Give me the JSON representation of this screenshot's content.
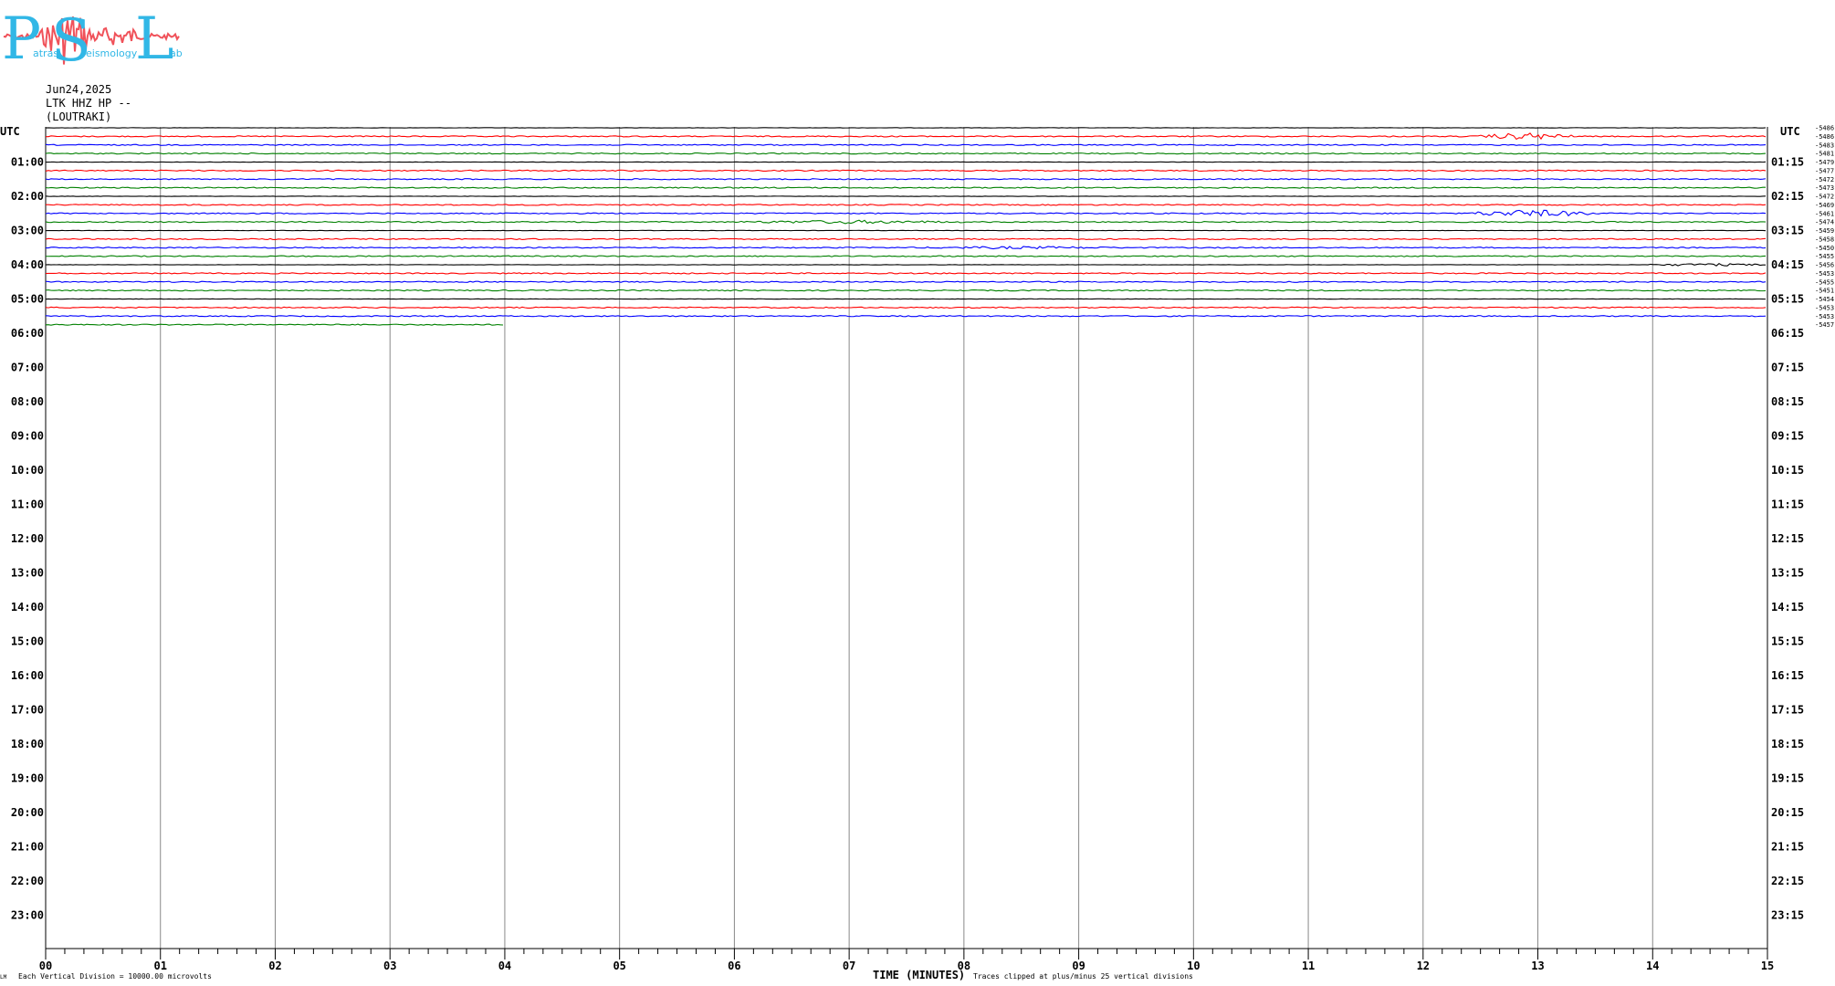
{
  "logo": {
    "letters": [
      "P",
      "S",
      "L"
    ],
    "fragments": [
      "atras",
      "eismology",
      "ab"
    ],
    "colors": {
      "letters": "#31b7e6",
      "trace": "#f0525a"
    }
  },
  "header": {
    "date": "Jun24,2025",
    "channel": "LTK HHZ HP --",
    "station": "(LOUTRAKI)"
  },
  "chart_data": {
    "type": "line",
    "x_axis_label": "TIME (MINUTES)",
    "x_range": [
      0,
      15
    ],
    "x_ticks": [
      "00",
      "01",
      "02",
      "03",
      "04",
      "05",
      "06",
      "07",
      "08",
      "09",
      "10",
      "11",
      "12",
      "13",
      "14",
      "15"
    ],
    "left_time_header": "UTC",
    "right_time_header": "UTC",
    "left_hour_labels": [
      "01:00",
      "02:00",
      "03:00",
      "04:00",
      "05:00",
      "06:00",
      "07:00",
      "08:00",
      "09:00",
      "10:00",
      "11:00",
      "12:00",
      "13:00",
      "14:00",
      "15:00",
      "16:00",
      "17:00",
      "18:00",
      "19:00",
      "20:00",
      "21:00",
      "22:00",
      "23:00"
    ],
    "right_hour_labels": [
      "01:15",
      "02:15",
      "03:15",
      "04:15",
      "05:15",
      "06:15",
      "07:15",
      "08:15",
      "09:15",
      "10:15",
      "11:15",
      "12:15",
      "13:15",
      "14:15",
      "15:15",
      "16:15",
      "17:15",
      "18:15",
      "19:15",
      "20:15",
      "21:15",
      "22:15",
      "23:15"
    ],
    "rows_per_hour": 4,
    "trace_color_cycle": [
      "#000000",
      "#ff0000",
      "#0000ff",
      "#008000"
    ],
    "trace_offsets": [
      "-5486",
      "-5486",
      "-5483",
      "-5481",
      "-5479",
      "-5477",
      "-5472",
      "-5473",
      "-5472",
      "-5469",
      "-5461",
      "-5474",
      "-5459",
      "-5458",
      "-5450",
      "-5455",
      "-5456",
      "-5453",
      "-5455",
      "-5451",
      "-5454",
      "-5453",
      "-5453",
      "-5457"
    ],
    "last_row_end_minute": 4,
    "events": [
      {
        "row": 1,
        "start": 12.5,
        "end": 13.3,
        "amp": 4
      },
      {
        "row": 10,
        "start": 12.4,
        "end": 13.5,
        "amp": 4
      },
      {
        "row": 11,
        "start": 6.0,
        "end": 8.0,
        "amp": 2
      },
      {
        "row": 14,
        "start": 7.5,
        "end": 9.5,
        "amp": 1.5
      },
      {
        "row": 16,
        "start": 13.95,
        "end": 15,
        "amp": 1.5
      }
    ],
    "footer_left": "Each Vertical Division = 10000.00 microvolts",
    "footer_right": "Traces clipped at plus/minus 25 vertical divisions",
    "corner_mark": "LM"
  }
}
